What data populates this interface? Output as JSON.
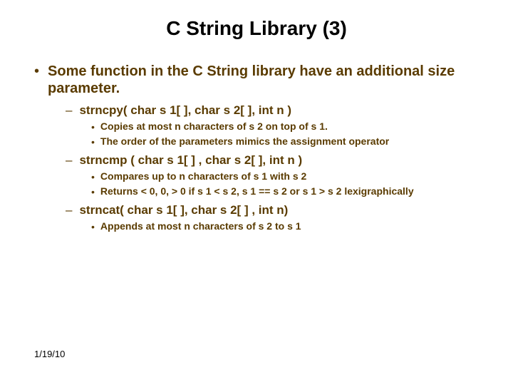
{
  "title": "C String Library (3)",
  "main_bullet": "Some function in the C String library have an additional size parameter.",
  "items": [
    {
      "sig": "strncpy( char s 1[  ], char s 2[  ], int n )",
      "subs": [
        "Copies at most n characters of s 2 on top of s 1.",
        "The order of the parameters mimics the assignment operator"
      ]
    },
    {
      "sig": "strncmp ( char s 1[  ] , char s 2[  ], int n )",
      "subs": [
        "Compares up to n characters of s 1 with s 2",
        "Returns < 0, 0, > 0 if s 1 < s 2, s 1  == s 2 or s 1 > s 2 lexigraphically"
      ]
    },
    {
      "sig": "strncat( char s 1[  ], char s 2[  ] , int n)",
      "subs": [
        "Appends at most n characters of s 2 to s 1"
      ]
    }
  ],
  "footer_date": "1/19/10"
}
